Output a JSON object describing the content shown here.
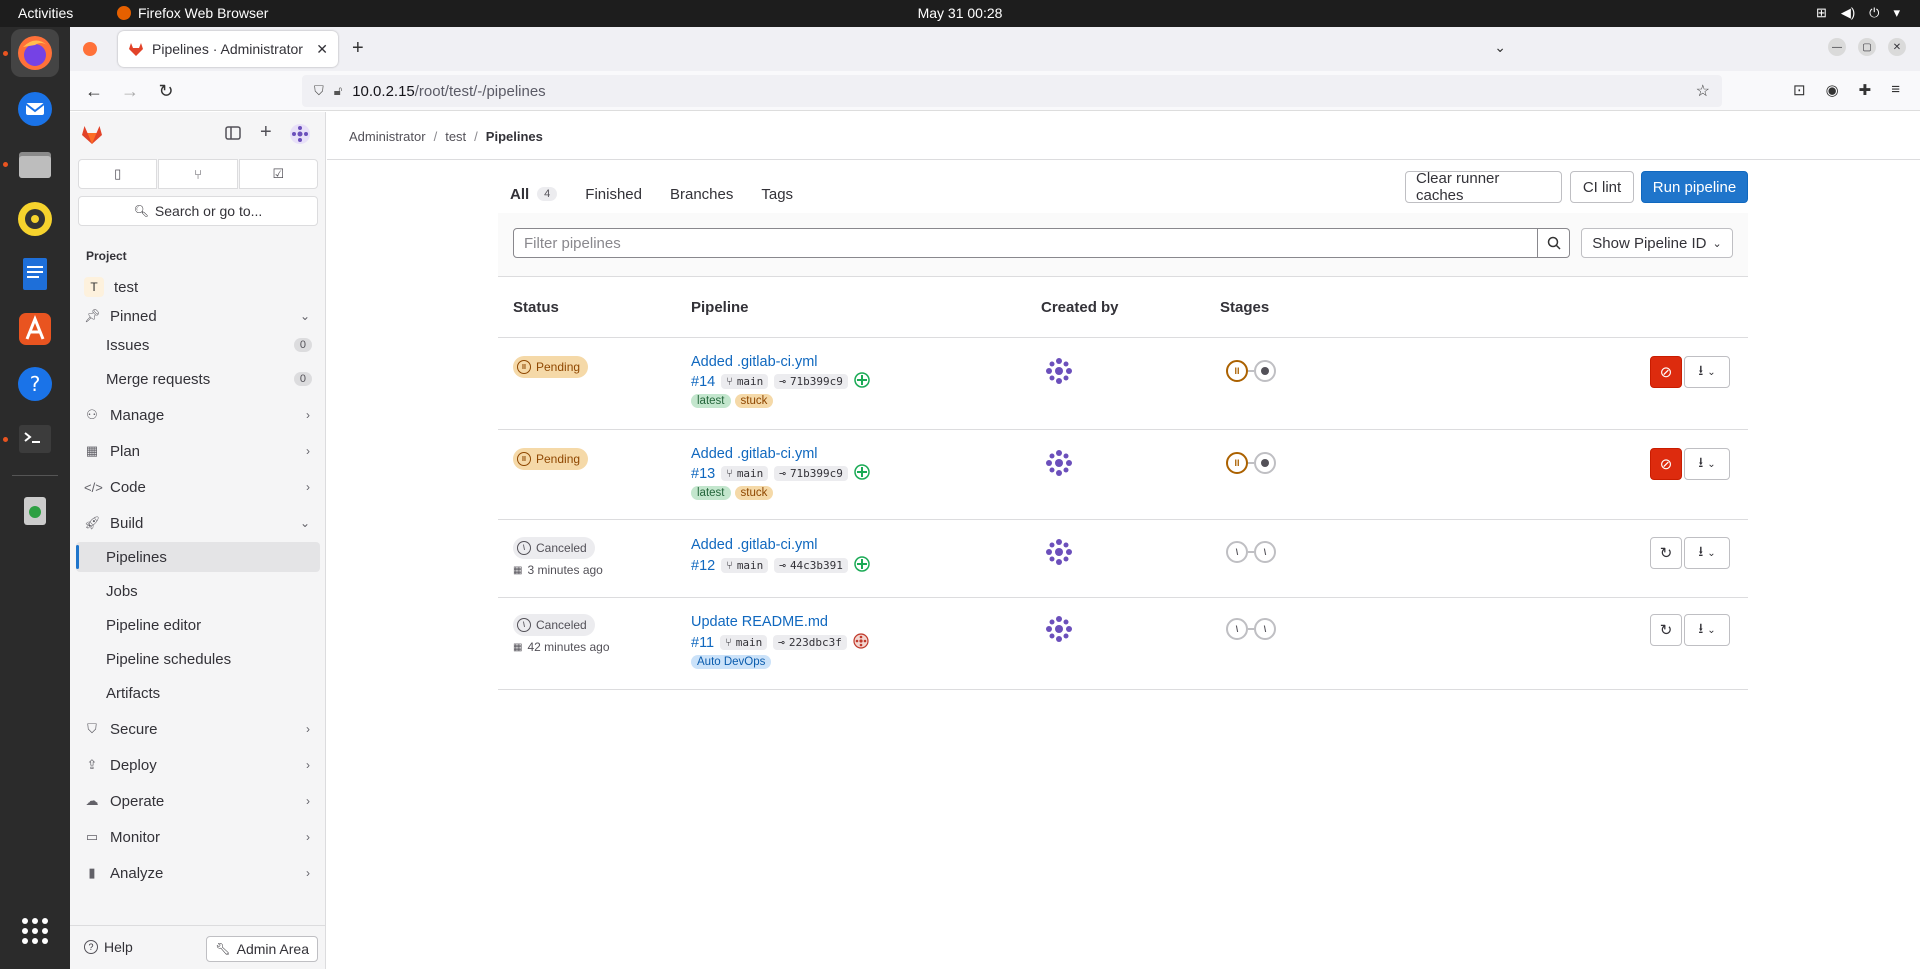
{
  "system": {
    "activities": "Activities",
    "app_name": "Firefox Web Browser",
    "clock": "May 31  00:28"
  },
  "browser": {
    "tab_title": "Pipelines · Administrator",
    "url_host": "10.0.2.15",
    "url_path": "/root/test/-/pipelines"
  },
  "sidebar": {
    "search": "Search or go to...",
    "section": "Project",
    "project_initial": "T",
    "project_name": "test",
    "items": [
      {
        "label": "Pinned"
      },
      {
        "label": "Issues",
        "count": "0"
      },
      {
        "label": "Merge requests",
        "count": "0"
      },
      {
        "label": "Manage"
      },
      {
        "label": "Plan"
      },
      {
        "label": "Code"
      },
      {
        "label": "Build"
      },
      {
        "label": "Pipelines"
      },
      {
        "label": "Jobs"
      },
      {
        "label": "Pipeline editor"
      },
      {
        "label": "Pipeline schedules"
      },
      {
        "label": "Artifacts"
      },
      {
        "label": "Secure"
      },
      {
        "label": "Deploy"
      },
      {
        "label": "Operate"
      },
      {
        "label": "Monitor"
      },
      {
        "label": "Analyze"
      }
    ],
    "help": "Help",
    "admin": "Admin Area"
  },
  "breadcrumb": [
    "Administrator",
    "test",
    "Pipelines"
  ],
  "tabs": [
    {
      "label": "All",
      "count": "4"
    },
    {
      "label": "Finished"
    },
    {
      "label": "Branches"
    },
    {
      "label": "Tags"
    }
  ],
  "buttons": {
    "clear_cache": "Clear runner caches",
    "ci_lint": "CI lint",
    "run_pipeline": "Run pipeline"
  },
  "filter": {
    "placeholder": "Filter pipelines",
    "select": "Show Pipeline ID"
  },
  "columns": [
    "Status",
    "Pipeline",
    "Created by",
    "Stages"
  ],
  "pipelines": [
    {
      "status": "Pending",
      "title": "Added .gitlab-ci.yml",
      "id": "#14",
      "branch": "main",
      "sha": "71b399c9",
      "tags": [
        "latest",
        "stuck"
      ]
    },
    {
      "status": "Pending",
      "title": "Added .gitlab-ci.yml",
      "id": "#13",
      "branch": "main",
      "sha": "71b399c9",
      "tags": [
        "latest",
        "stuck"
      ]
    },
    {
      "status": "Canceled",
      "time": "3 minutes ago",
      "title": "Added .gitlab-ci.yml",
      "id": "#12",
      "branch": "main",
      "sha": "44c3b391"
    },
    {
      "status": "Canceled",
      "time": "42 minutes ago",
      "title": "Update README.md",
      "id": "#11",
      "branch": "main",
      "sha": "223dbc3f",
      "tags": [
        "Auto DevOps"
      ]
    }
  ],
  "colors": {
    "accent": "#1f75cb",
    "pending": "#ab6100",
    "danger": "#dd2b0e"
  }
}
